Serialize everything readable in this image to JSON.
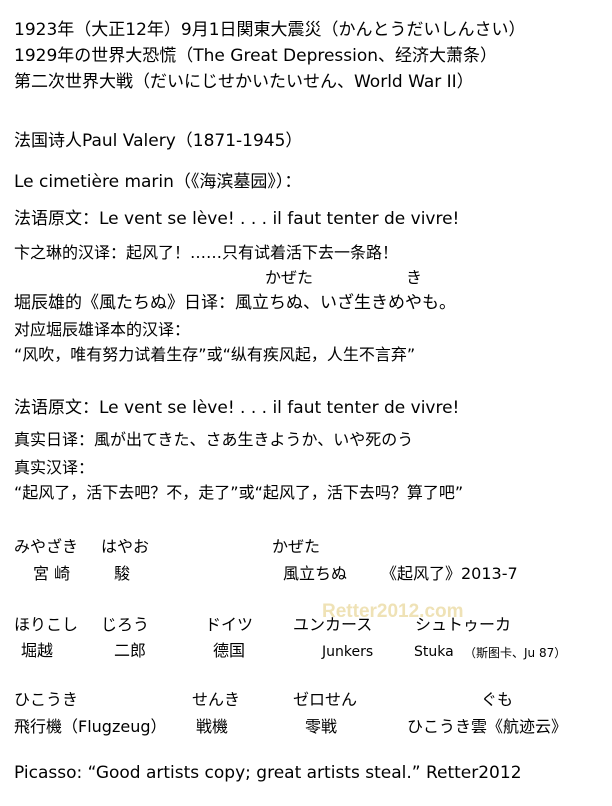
{
  "header_lines": [
    "1923年（大正12年）9月1日関東大震災（かんとうだいしんさい）",
    "1929年の世界大恐慌（The Great Depression、经济大萧条）",
    "第二次世界大戦（だいにじせかいたいせん、World War II）"
  ],
  "poet": "法国诗人Paul Valery（1871-1945）",
  "poem_title": "Le cimetière marin（《海滨墓园》）：",
  "block1": {
    "original": "法语原文：Le vent se lève! . . . il faut tenter de vivre!",
    "bian_translation": "卞之琳的汉译：起风了！……只有试着活下去一条路！",
    "ruby_kazeta": "かぜた",
    "ruby_ki": "き",
    "hori_translation": "堀辰雄的《風たちぬ》日译：風立ちぬ、いざ生きめやも。",
    "corresponding_label": "对应堀辰雄译本的汉译：",
    "corresponding_text": "“风吹，唯有努力试着生存”或“纵有疾风起，人生不言弃”"
  },
  "block2": {
    "original": "法语原文：Le vent se lève! . . . il faut tenter de vivre!",
    "real_jp": "真实日译：風が出てきた、さあ生きようか、いや死のう",
    "real_cn_label": "真实汉译：",
    "real_cn_text": "“起风了，活下去吧？不，走了”或“起风了，活下去吗？算了吧”"
  },
  "names_row1": {
    "miyazaki_kana": "みやざき",
    "hayao_kana": "はやお",
    "kazeta_kana": "かぜた",
    "miyazaki": "宮 崎",
    "hayao": "駿",
    "kazetachinu": "風立ちぬ",
    "kazetachinu_cn": "《起风了》2013-7"
  },
  "names_row2": {
    "horikoshi_kana": "ほりこし",
    "jirou_kana": "じろう",
    "doitsu_kana": "ドイツ",
    "junkers_kana": "ユンカース",
    "stuka_kana": "シュトゥーカ",
    "horikoshi": "堀越",
    "jirou": "二郎",
    "germany": "德国",
    "junkers": "Junkers",
    "stuka": "Stuka",
    "stuka_note": "（斯图卡、Ju 87）"
  },
  "names_row3": {
    "hikouki_kana": "ひこうき",
    "senki_kana": "せんき",
    "zerosen_kana": "ゼロせん",
    "gumo_kana": "ぐも",
    "hikouki": "飛行機（Flugzeug）",
    "senki": "戦機",
    "zerosen": "零戦",
    "hikoukigumo": "ひこうき雲《航迹云》"
  },
  "quote": "Picasso: “Good artists copy; great artists steal.” Retter2012",
  "watermark": "Retter2012.com"
}
